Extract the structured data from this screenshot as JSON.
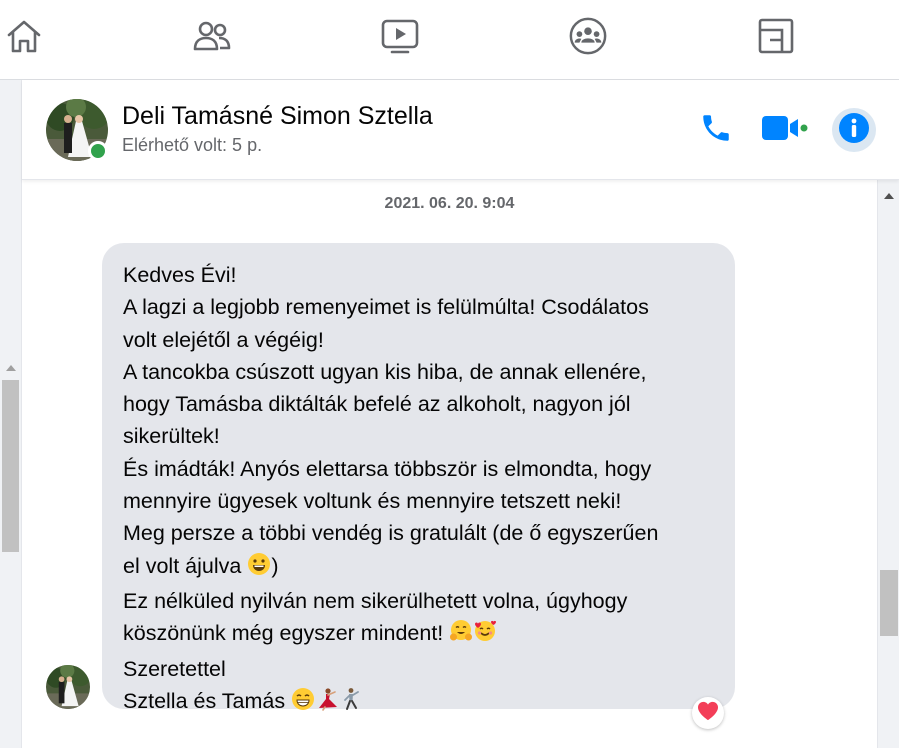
{
  "nav": {
    "items": [
      {
        "name": "home-icon"
      },
      {
        "name": "friends-icon"
      },
      {
        "name": "watch-icon"
      },
      {
        "name": "groups-icon"
      },
      {
        "name": "gaming-icon"
      }
    ]
  },
  "conversation": {
    "contact_name": "Deli Tamásné Simon Sztella",
    "status": "Elérhető volt: 5 p.",
    "online": true,
    "accent_color": "#0084ff",
    "online_color": "#31a24c",
    "actions": [
      "phone-icon",
      "video-camera-icon",
      "info-icon"
    ]
  },
  "message": {
    "timestamp": "2021. 06. 20. 9:04",
    "lines": [
      "Kedves Évi!",
      "A lagzi a legjobb remenyeimet is felülmúlta! Csodálatos",
      "volt elejétől a végéig!",
      "A tancokba csúszott ugyan kis hiba, de annak ellenére,",
      "hogy Tamásba diktálták befelé az alkoholt, nagyon jól",
      "sikerültek!",
      "És imádták! Anyós elettarsa többször is elmondta, hogy",
      "mennyire ügyesek voltunk és mennyire tetszett neki!",
      "Meg persze a többi vendég is gratulált (de ő egyszerűen",
      "el volt ájulva",
      ")",
      "Ez nélküled nyilván nem sikerülhetett volna, úgyhogy",
      "köszönünk még egyszer mindent!",
      "Szeretettel",
      "Sztella és Tamás"
    ],
    "reaction": "heart",
    "reaction_color": "#f33e58"
  }
}
